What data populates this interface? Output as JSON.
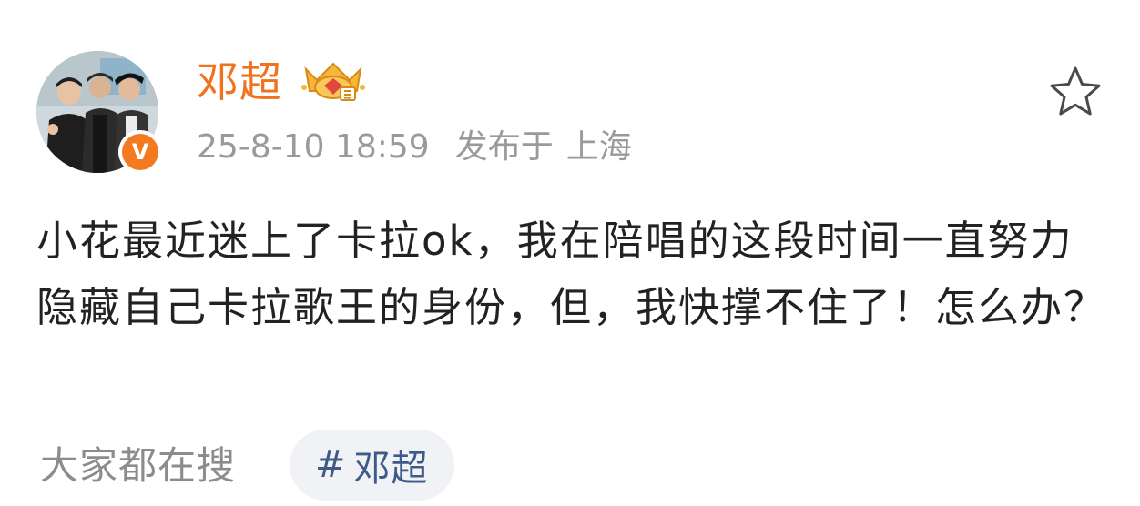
{
  "post": {
    "author": {
      "name": "邓超",
      "avatar_icon": "group-photo-avatar",
      "verified_badge": "V",
      "crown_badge_icon": "crown-badge-icon"
    },
    "timestamp": "25-8-10 18:59",
    "published_label": "发布于",
    "location": "上海",
    "text": "小花最近迷上了卡拉ok，我在陪唱的这段时间一直努力隐藏自己卡拉歌王的身份，但，我快撑不住了！怎么办？"
  },
  "footer": {
    "label": "大家都在搜",
    "tag_hash": "#",
    "tag_text": "邓超"
  },
  "colors": {
    "username": "#f2711c",
    "verified": "#f47a1f",
    "meta": "#9a9a9a",
    "body_text": "#222222",
    "tag_text": "#3f5a88",
    "tag_bg": "#f0f2f6"
  }
}
